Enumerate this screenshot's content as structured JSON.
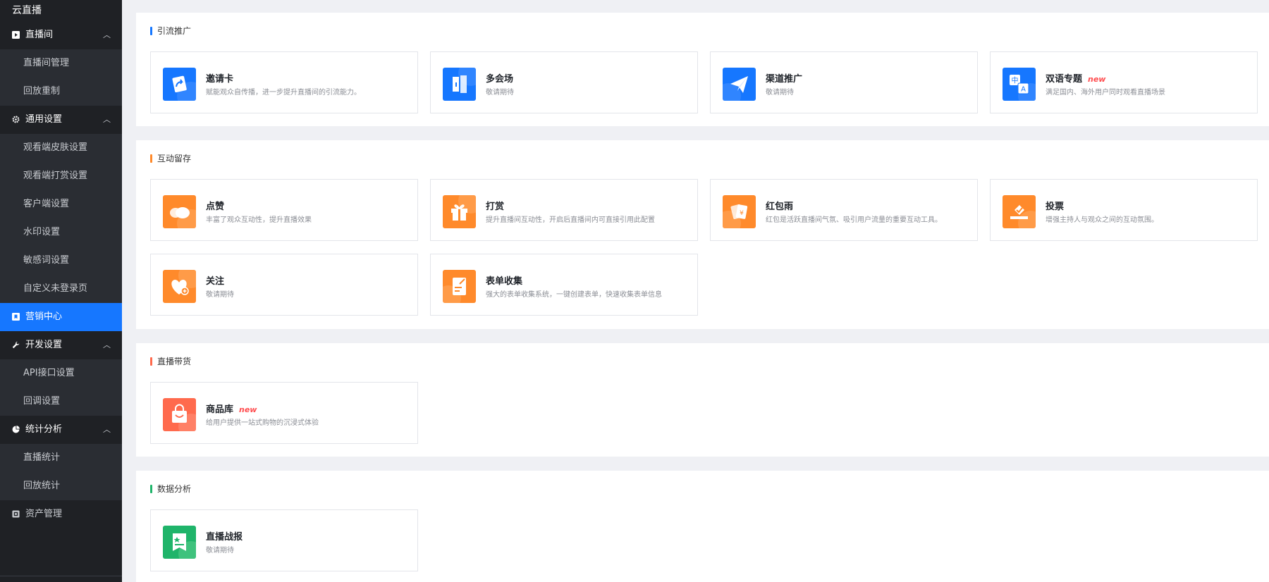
{
  "sidebar": {
    "brand": "云直播",
    "groups": [
      {
        "label": "直播间",
        "caret": "^",
        "items": [
          "直播间管理",
          "回放重制"
        ]
      },
      {
        "label": "通用设置",
        "caret": "^",
        "items": [
          "观看端皮肤设置",
          "观看端打赏设置",
          "客户端设置",
          "水印设置",
          "敏感词设置",
          "自定义未登录页"
        ]
      },
      {
        "label": "营销中心"
      },
      {
        "label": "开发设置",
        "caret": "^",
        "items": [
          "API接口设置",
          "回调设置"
        ]
      },
      {
        "label": "统计分析",
        "caret": "^",
        "items": [
          "直播统计",
          "回放统计"
        ]
      },
      {
        "label": "资产管理"
      }
    ]
  },
  "sections": [
    {
      "title": "引流推广",
      "color": "#1677ff",
      "cards": [
        {
          "title": "邀请卡",
          "desc": "赋能观众自传播，进一步提升直播间的引流能力。",
          "icon": "share-card-icon"
        },
        {
          "title": "多会场",
          "desc": "敬请期待",
          "icon": "multi-venue-icon"
        },
        {
          "title": "渠道推广",
          "desc": "敬请期待",
          "icon": "paper-plane-icon"
        },
        {
          "title": "双语专题",
          "badge": "new",
          "desc": "满足国内、海外用户同时观看直播场景",
          "icon": "translate-icon"
        }
      ]
    },
    {
      "title": "互动留存",
      "color": "#ff8a2b",
      "cards": [
        {
          "title": "点赞",
          "desc": "丰富了观众互动性，提升直播效果",
          "icon": "like-cloud-icon"
        },
        {
          "title": "打赏",
          "desc": "提升直播间互动性，开启后直播间内可直接引用此配置",
          "icon": "gift-icon"
        },
        {
          "title": "红包雨",
          "desc": "红包是活跃直播间气氛、吸引用户流量的重要互动工具。",
          "icon": "red-packet-icon"
        },
        {
          "title": "投票",
          "desc": "增强主持人与观众之间的互动氛围。",
          "icon": "vote-icon"
        },
        {
          "title": "关注",
          "desc": "敬请期待",
          "icon": "follow-heart-icon"
        },
        {
          "title": "表单收集",
          "desc": "强大的表单收集系统，一键创建表单，快速收集表单信息",
          "icon": "form-icon"
        }
      ]
    },
    {
      "title": "直播带货",
      "color": "#ff6a4d",
      "cards": [
        {
          "title": "商品库",
          "badge": "new",
          "desc": "给用户提供一站式购物的沉浸式体验",
          "icon": "shopping-bag-icon"
        }
      ]
    },
    {
      "title": "数据分析",
      "color": "#1fb46a",
      "cards": [
        {
          "title": "直播战报",
          "desc": "敬请期待",
          "icon": "report-icon"
        }
      ]
    }
  ]
}
